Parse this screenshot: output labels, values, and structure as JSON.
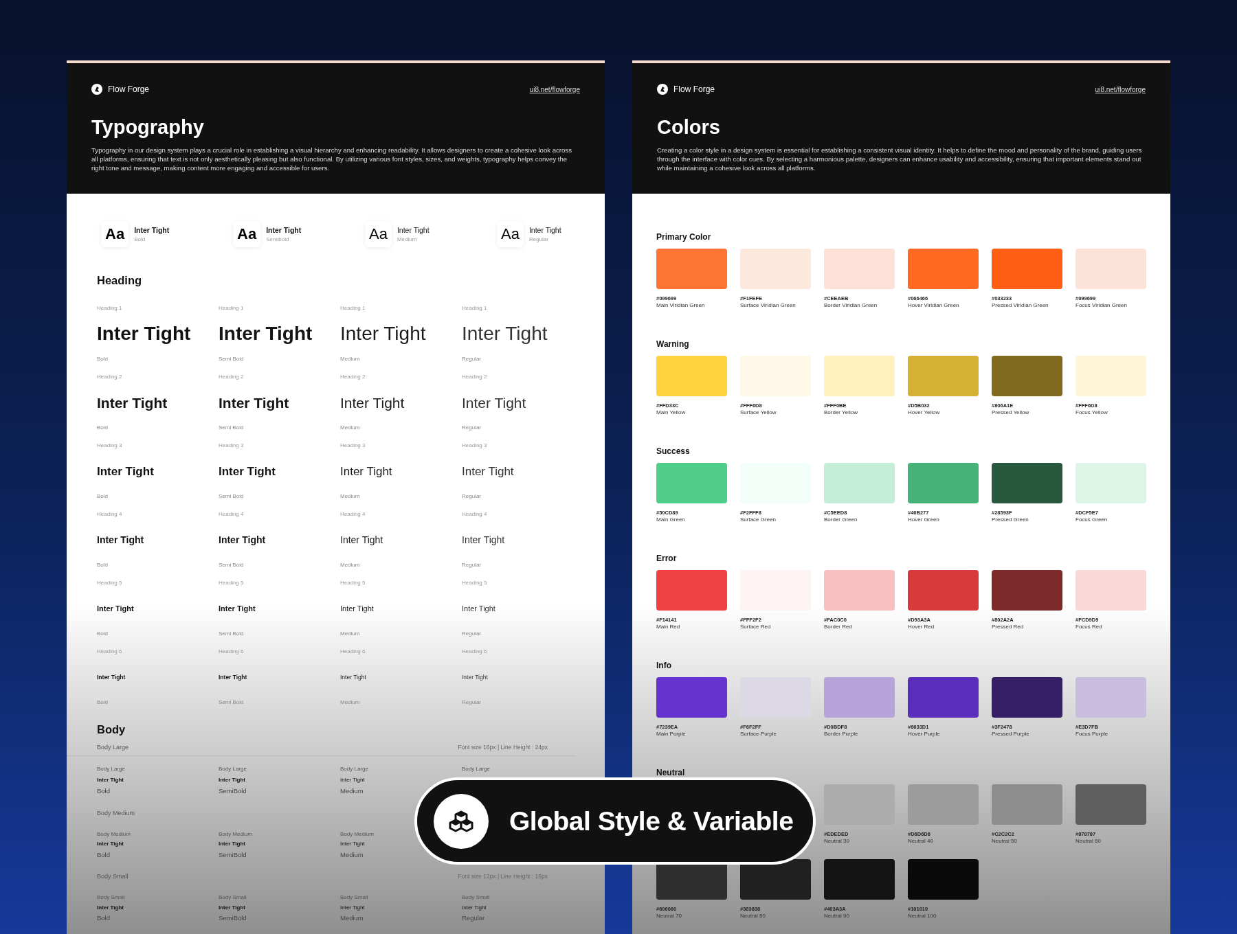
{
  "typography_panel": {
    "brand": "Flow Forge",
    "link": "ui8.net/flowforge",
    "title": "Typography",
    "description": "Typography in our design system plays a crucial role in establishing a visual hierarchy and enhancing readability. It allows designers to create a cohesive look across all platforms, ensuring that text is not only aesthetically pleasing but also functional. By utilizing various font styles, sizes, and weights, typography helps convey the right tone and message, making content more engaging and accessible for users.",
    "font_cards": [
      {
        "sample": "Aa",
        "name": "Inter Tight",
        "weight_name": "Bold"
      },
      {
        "sample": "Aa",
        "name": "Inter Tight",
        "weight_name": "Semibold"
      },
      {
        "sample": "Aa",
        "name": "Inter Tight",
        "weight_name": "Medium"
      },
      {
        "sample": "Aa",
        "name": "Inter Tight",
        "weight_name": "Regular"
      }
    ],
    "heading_title": "Heading",
    "heading_rows": [
      {
        "kind": "h1",
        "cells": [
          {
            "label": "Heading 1",
            "sample": "Inter Tight",
            "weight_name": "Bold"
          },
          {
            "label": "Heading 1",
            "sample": "Inter Tight",
            "weight_name": "Semi Bold"
          },
          {
            "label": "Heading 1",
            "sample": "Inter Tight",
            "weight_name": "Medium"
          },
          {
            "label": "Heading 1",
            "sample": "Inter Tight",
            "weight_name": "Regular"
          }
        ]
      },
      {
        "kind": "h2",
        "cells": [
          {
            "label": "Heading 2",
            "sample": "Inter Tight",
            "weight_name": "Bold"
          },
          {
            "label": "Heading 2",
            "sample": "Inter Tight",
            "weight_name": "Semi Bold"
          },
          {
            "label": "Heading 2",
            "sample": "Inter Tight",
            "weight_name": "Medium"
          },
          {
            "label": "Heading 2",
            "sample": "Inter Tight",
            "weight_name": "Regular"
          }
        ]
      },
      {
        "kind": "h3",
        "cells": [
          {
            "label": "Heading 3",
            "sample": "Inter Tight",
            "weight_name": "Bold"
          },
          {
            "label": "Heading 3",
            "sample": "Inter Tight",
            "weight_name": "Semi Bold"
          },
          {
            "label": "Heading 3",
            "sample": "Inter Tight",
            "weight_name": "Medium"
          },
          {
            "label": "Heading 3",
            "sample": "Inter Tight",
            "weight_name": "Regular"
          }
        ]
      },
      {
        "kind": "h4",
        "cells": [
          {
            "label": "Heading 4",
            "sample": "Inter Tight",
            "weight_name": "Bold"
          },
          {
            "label": "Heading 4",
            "sample": "Inter Tight",
            "weight_name": "Semi Bold"
          },
          {
            "label": "Heading 4",
            "sample": "Inter Tight",
            "weight_name": "Medium"
          },
          {
            "label": "Heading 4",
            "sample": "Inter Tight",
            "weight_name": "Regular"
          }
        ]
      },
      {
        "kind": "h5",
        "cells": [
          {
            "label": "Heading 5",
            "sample": "Inter Tight",
            "weight_name": "Bold"
          },
          {
            "label": "Heading 5",
            "sample": "Inter Tight",
            "weight_name": "Semi Bold"
          },
          {
            "label": "Heading 5",
            "sample": "Inter Tight",
            "weight_name": "Medium"
          },
          {
            "label": "Heading 5",
            "sample": "Inter Tight",
            "weight_name": "Regular"
          }
        ]
      },
      {
        "kind": "h6",
        "cells": [
          {
            "label": "Heading 6",
            "sample": "Inter Tight",
            "weight_name": "Bold"
          },
          {
            "label": "Heading 6",
            "sample": "Inter Tight",
            "weight_name": "Semi Bold"
          },
          {
            "label": "Heading 6",
            "sample": "Inter Tight",
            "weight_name": "Medium"
          },
          {
            "label": "Heading 6",
            "sample": "Inter Tight",
            "weight_name": "Regular"
          }
        ]
      }
    ],
    "body_title": "Body",
    "body_groups": [
      {
        "kind": "large",
        "label": "Body Large",
        "spec": "Font size 16px | Line Height : 24px",
        "cells": [
          {
            "label": "Body Large",
            "sample": "Inter Tight",
            "weight_name": "Bold"
          },
          {
            "label": "Body Large",
            "sample": "Inter Tight",
            "weight_name": "SemiBold"
          },
          {
            "label": "Body Large",
            "sample": "Inter Tight",
            "weight_name": "Medium"
          },
          {
            "label": "Body Large"
          }
        ]
      },
      {
        "kind": "medium",
        "label": "Body Medium",
        "cells": [
          {
            "label": "Body Medium",
            "sample": "Inter Tight",
            "weight_name": "Bold"
          },
          {
            "label": "Body Medium",
            "sample": "Inter Tight",
            "weight_name": "SemiBold"
          },
          {
            "label": "Body Medium",
            "sample": "Inter Tight",
            "weight_name": "Medium"
          }
        ]
      },
      {
        "kind": "small",
        "label": "Body Small",
        "spec": "Font size 12px | Line Height : 16px",
        "cells": [
          {
            "label": "Body Small",
            "sample": "Inter Tight",
            "weight_name": "Bold"
          },
          {
            "label": "Body Small",
            "sample": "Inter Tight",
            "weight_name": "SemiBold"
          },
          {
            "label": "Body Small",
            "sample": "Inter Tight",
            "weight_name": "Medium"
          },
          {
            "label": "Body Small",
            "sample": "Inter Tight",
            "weight_name": "Regular"
          }
        ]
      }
    ]
  },
  "colors_panel": {
    "brand": "Flow Forge",
    "link": "ui8.net/flowforge",
    "title": "Colors",
    "description": "Creating a color style in a design system is essential for establishing a consistent visual identity. It helps to define the mood and personality of the brand, guiding users through the interface with color cues. By selecting a harmonious palette, designers can enhance usability and accessibility, ensuring that important elements stand out while maintaining a cohesive look across all platforms.",
    "groups": [
      {
        "title": "Primary Color",
        "swatches": [
          {
            "hex": "#099699",
            "name": "Main Viridian Green",
            "color": "#fd7433"
          },
          {
            "hex": "#F1FEFE",
            "name": "Surface Viridian Green",
            "color": "#fde8de"
          },
          {
            "hex": "#CEEAEB",
            "name": "Border Viridian Green",
            "color": "#fde0d6"
          },
          {
            "hex": "#066466",
            "name": "Hover Viridian Green",
            "color": "#fe6a21"
          },
          {
            "hex": "#033233",
            "name": "Pressed Viridian Green",
            "color": "#ff5f15"
          },
          {
            "hex": "#099699",
            "name": "Focus Viridian Green",
            "color": "#fde2d8"
          }
        ]
      },
      {
        "title": "Warning",
        "swatches": [
          {
            "hex": "#FFD33C",
            "name": "Main Yellow",
            "color": "#ffd33c"
          },
          {
            "hex": "#FFF6D8",
            "name": "Surface Yellow",
            "color": "#fff8e6"
          },
          {
            "hex": "#FFF0BE",
            "name": "Border Yellow",
            "color": "#fff0be"
          },
          {
            "hex": "#D5B032",
            "name": "Hover Yellow",
            "color": "#d5b032"
          },
          {
            "hex": "#806A1E",
            "name": "Pressed Yellow",
            "color": "#806a1e"
          },
          {
            "hex": "#FFF6D8",
            "name": "Focus Yellow",
            "color": "#fff6d8"
          }
        ]
      },
      {
        "title": "Success",
        "swatches": [
          {
            "hex": "#50CD89",
            "name": "Main Green",
            "color": "#50cd89"
          },
          {
            "hex": "#F2FFF8",
            "name": "Surface Green",
            "color": "#f2fff8"
          },
          {
            "hex": "#C5EED8",
            "name": "Border Green",
            "color": "#c5eed8"
          },
          {
            "hex": "#46B277",
            "name": "Hover Green",
            "color": "#46b277"
          },
          {
            "hex": "#28593F",
            "name": "Pressed Green",
            "color": "#28593f"
          },
          {
            "hex": "#DCF5E7",
            "name": "Focus Green",
            "color": "#dcf5e7"
          }
        ]
      },
      {
        "title": "Error",
        "swatches": [
          {
            "hex": "#F14141",
            "name": "Main Red",
            "color": "#ef4141"
          },
          {
            "hex": "#FFF2F2",
            "name": "Surface Red",
            "color": "#fdf3f2"
          },
          {
            "hex": "#FAC0C0",
            "name": "Border Red",
            "color": "#f8c0c0"
          },
          {
            "hex": "#D93A3A",
            "name": "Hover Red",
            "color": "#d73a3a"
          },
          {
            "hex": "#802A2A",
            "name": "Pressed Red",
            "color": "#7f2a2a"
          },
          {
            "hex": "#FCD9D9",
            "name": "Focus Red",
            "color": "#fad8d8"
          }
        ]
      },
      {
        "title": "Info",
        "swatches": [
          {
            "hex": "#7239EA",
            "name": "Main Purple",
            "color": "#6633d1"
          },
          {
            "hex": "#F6F2FF",
            "name": "Surface Purple",
            "color": "#dcd8e6"
          },
          {
            "hex": "#D0BDF8",
            "name": "Border Purple",
            "color": "#b6a4da"
          },
          {
            "hex": "#6633D1",
            "name": "Hover Purple",
            "color": "#5a2dbb"
          },
          {
            "hex": "#3F2478",
            "name": "Pressed Purple",
            "color": "#371f68"
          },
          {
            "hex": "#E3D7FB",
            "name": "Focus Purple",
            "color": "#c9bee0"
          }
        ]
      },
      {
        "title": "Neutral",
        "kind": "neutral",
        "swatches": [
          {
            "hex": "#EDEDED",
            "name": "Neutral 30",
            "color": "#acacac"
          },
          {
            "hex": "#D6D6D6",
            "name": "Neutral 40",
            "color": "#9c9c9c"
          },
          {
            "hex": "#C2C2C2",
            "name": "Neutral 50",
            "color": "#8e8e8e"
          },
          {
            "hex": "#878787",
            "name": "Neutral 60",
            "color": "#5e5e5e"
          },
          {
            "hex": "#606060",
            "name": "Neutral 70",
            "color": "#2e2e2e"
          },
          {
            "hex": "#383838",
            "name": "Neutral 80",
            "color": "#202020"
          },
          {
            "hex": "#403A3A",
            "name": "Neutral 90",
            "color": "#141414"
          },
          {
            "hex": "#101010",
            "name": "Neutral 100",
            "color": "#0a0a0a"
          }
        ]
      }
    ]
  },
  "badge": {
    "label": "Global Style & Variable"
  }
}
